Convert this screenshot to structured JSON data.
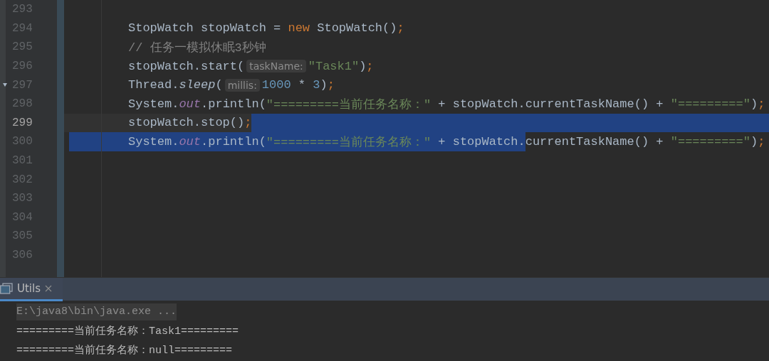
{
  "editor": {
    "lines": [
      {
        "number": "293",
        "current": false
      },
      {
        "number": "294",
        "current": false,
        "items": [
          {
            "kind": "code",
            "selected": false,
            "tokens": [
              {
                "text": "StopWatch stopWatch = ",
                "kind": "plain"
              },
              {
                "text": "new",
                "kind": "keyword"
              },
              {
                "text": " StopWatch()",
                "kind": "plain"
              },
              {
                "text": ";",
                "kind": "punct"
              }
            ]
          }
        ]
      },
      {
        "number": "295",
        "current": false,
        "items": [
          {
            "kind": "code",
            "selected": false,
            "tokens": [
              {
                "text": "// 任务一模拟休眠3秒钟",
                "kind": "comment"
              }
            ]
          }
        ]
      },
      {
        "number": "296",
        "current": false,
        "items": [
          {
            "kind": "code",
            "selected": false,
            "tokens": [
              {
                "text": "stopWatch.start(",
                "kind": "plain"
              }
            ]
          },
          {
            "kind": "hint",
            "text": "taskName:"
          },
          {
            "kind": "code",
            "selected": false,
            "tokens": [
              {
                "text": "\"Task1\"",
                "kind": "string"
              },
              {
                "text": ")",
                "kind": "plain"
              },
              {
                "text": ";",
                "kind": "punct"
              }
            ]
          }
        ]
      },
      {
        "number": "297",
        "current": false,
        "fold_marker": true,
        "items": [
          {
            "kind": "code",
            "selected": false,
            "tokens": [
              {
                "text": "Thread.",
                "kind": "plain"
              },
              {
                "text": "sleep",
                "kind": "italic"
              },
              {
                "text": "(",
                "kind": "plain"
              }
            ]
          },
          {
            "kind": "hint",
            "text": "millis:"
          },
          {
            "kind": "code",
            "selected": false,
            "tokens": [
              {
                "text": "1000",
                "kind": "number"
              },
              {
                "text": " * ",
                "kind": "plain"
              },
              {
                "text": "3",
                "kind": "number"
              },
              {
                "text": ")",
                "kind": "plain"
              },
              {
                "text": ";",
                "kind": "punct"
              }
            ]
          }
        ]
      },
      {
        "number": "298",
        "current": false,
        "items": [
          {
            "kind": "code",
            "selected": false,
            "tokens": [
              {
                "text": "System.",
                "kind": "plain"
              },
              {
                "text": "out",
                "kind": "field"
              },
              {
                "text": ".println(",
                "kind": "plain"
              },
              {
                "text": "\"=========当前任务名称：\"",
                "kind": "string"
              },
              {
                "text": " + stopWatch.currentTaskName() + ",
                "kind": "plain"
              },
              {
                "text": "\"=========\"",
                "kind": "string"
              },
              {
                "text": ")",
                "kind": "plain"
              },
              {
                "text": ";",
                "kind": "punct"
              }
            ]
          }
        ]
      },
      {
        "number": "299",
        "current": true,
        "items": [
          {
            "kind": "code",
            "selected": false,
            "tokens": [
              {
                "text": "stopWatch.stop()",
                "kind": "plain"
              },
              {
                "text": ";",
                "kind": "punct"
              }
            ]
          },
          {
            "kind": "selection"
          }
        ]
      },
      {
        "number": "300",
        "current": false,
        "items": [
          {
            "kind": "selection"
          },
          {
            "kind": "code",
            "selected": true,
            "tokens": [
              {
                "text": "System.",
                "kind": "plain"
              },
              {
                "text": "out",
                "kind": "field"
              },
              {
                "text": ".println(",
                "kind": "plain"
              },
              {
                "text": "\"=========当前任务名称：\"",
                "kind": "string"
              },
              {
                "text": " + stopWatch.",
                "kind": "plain"
              }
            ]
          },
          {
            "kind": "code",
            "selected": false,
            "tokens": [
              {
                "text": "currentTaskName() + ",
                "kind": "plain"
              },
              {
                "text": "\"=========\"",
                "kind": "string"
              },
              {
                "text": ")",
                "kind": "plain"
              },
              {
                "text": ";",
                "kind": "punct"
              }
            ]
          }
        ]
      },
      {
        "number": "301",
        "current": false
      },
      {
        "number": "302",
        "current": false
      },
      {
        "number": "303",
        "current": false
      },
      {
        "number": "304",
        "current": false
      },
      {
        "number": "305",
        "current": false
      },
      {
        "number": "306",
        "current": false
      }
    ]
  },
  "run_panel": {
    "tabs": [
      {
        "label": "Utils",
        "selected": true
      }
    ],
    "console": [
      {
        "text": "E:\\java8\\bin\\java.exe ...",
        "kind": "command"
      },
      {
        "text": "=========当前任务名称：Task1=========",
        "kind": "output"
      },
      {
        "text": "=========当前任务名称：null=========",
        "kind": "output"
      }
    ]
  }
}
